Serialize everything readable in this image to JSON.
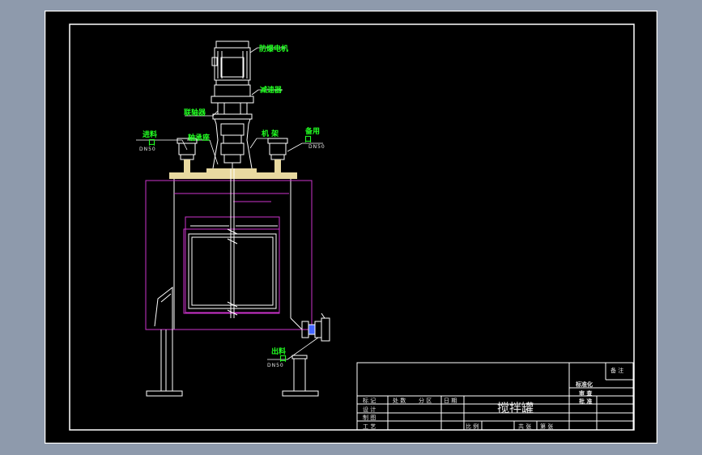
{
  "labels": {
    "motor": "防爆电机",
    "reducer": "减速器",
    "coupling": "联轴器",
    "bearing_seat": "轴承座",
    "frame": "机 架",
    "inlet": "进料",
    "inlet_mouth": "口",
    "inlet_spec": "DN50",
    "spare": "备用",
    "spare_mouth": "口",
    "spare_spec": "DN50",
    "outlet": "出料",
    "outlet_mouth": "口",
    "outlet_spec": "DN50"
  },
  "title_block": {
    "title": "搅拌罐",
    "remark": "备 注",
    "std": "标准化",
    "review": "审 查",
    "approve": "批 准",
    "col1": "标 记",
    "col2": "处 数",
    "col3": "分 区",
    "col4": "日 期",
    "row_design": "设 计",
    "row_draw": "制 图",
    "row_proc": "工 艺",
    "scale": "比 例",
    "sheet_total": "共 张",
    "sheet_no": "第 张"
  },
  "colors": {
    "background": "#8e9aac",
    "sheet": "#000000",
    "lines": "#ffffff",
    "dimension": "#cc33cc",
    "labels": "#22ff22",
    "flange": "#e8d9a0"
  }
}
